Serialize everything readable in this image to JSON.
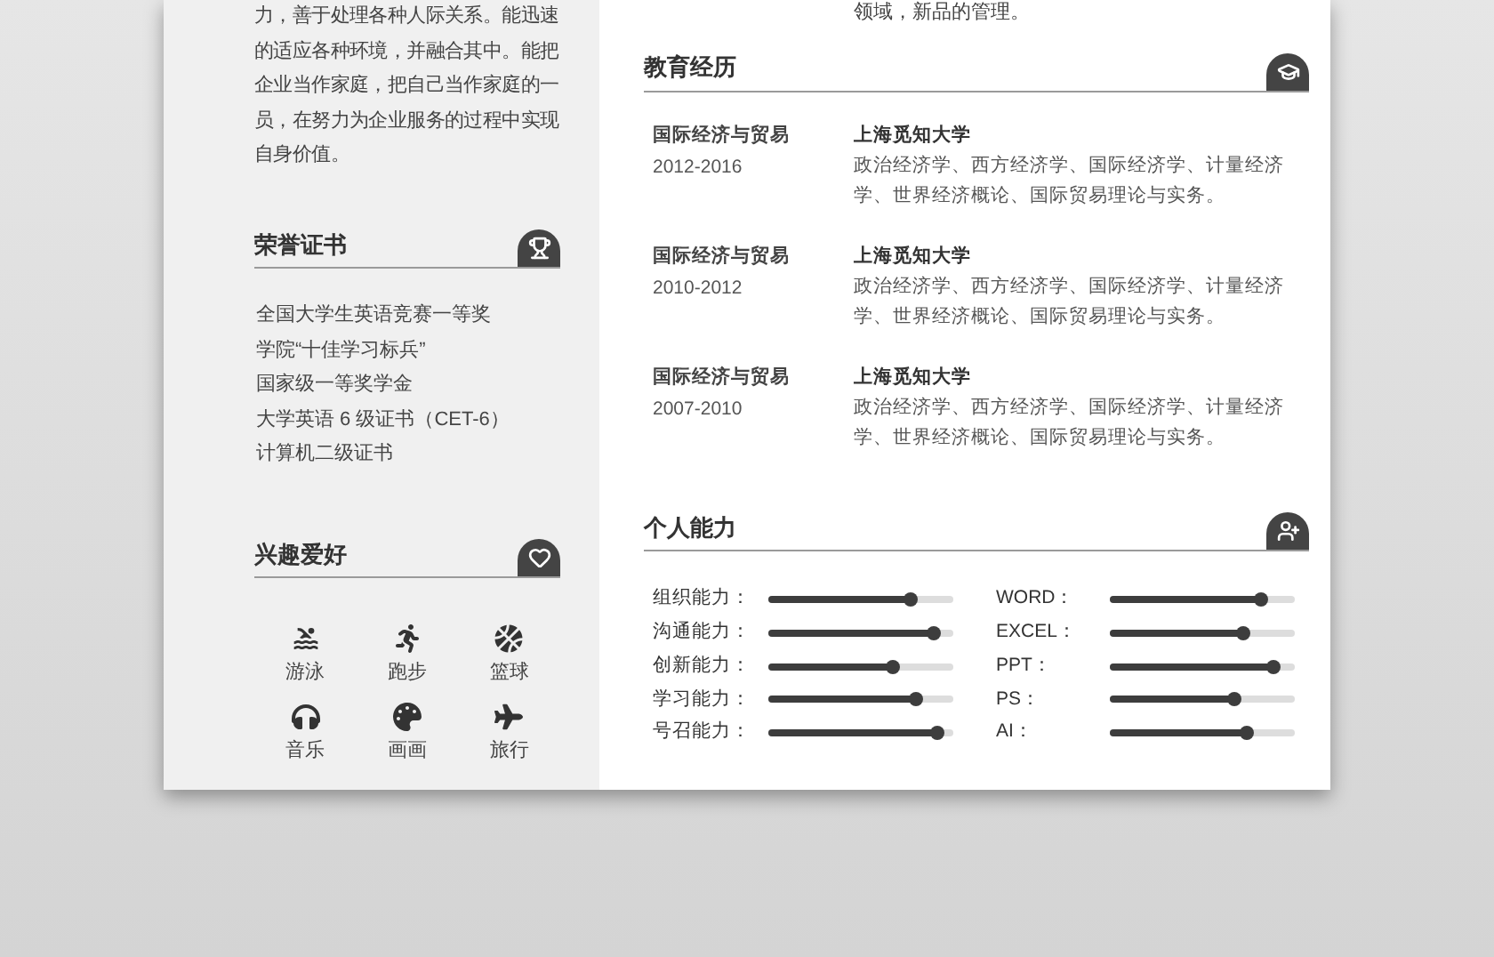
{
  "profile": {
    "text": "力，善于处理各种人际关系。能迅速的适应各种环境，并融合其中。能把企业当作家庭，把自己当作家庭的一员，在努力为企业服务的过程中实现自身价值。"
  },
  "work": {
    "text": "领域，新品的管理。"
  },
  "honors": {
    "title": "荣誉证书",
    "items": [
      "全国大学生英语竞赛一等奖",
      "学院“十佳学习标兵”",
      "国家级一等奖学金",
      "大学英语 6 级证书（CET-6）",
      "计算机二级证书"
    ]
  },
  "hobbies": {
    "title": "兴趣爱好",
    "items": [
      {
        "label": "游泳"
      },
      {
        "label": "跑步"
      },
      {
        "label": "篮球"
      },
      {
        "label": "音乐"
      },
      {
        "label": "画画"
      },
      {
        "label": "旅行"
      }
    ]
  },
  "education": {
    "title": "教育经历",
    "entries": [
      {
        "major": "国际经济与贸易",
        "years": "2012-2016",
        "school": "上海觅知大学",
        "courses": "政治经济学、西方经济学、国际经济学、计量经济学、世界经济概论、国际贸易理论与实务。"
      },
      {
        "major": "国际经济与贸易",
        "years": "2010-2012",
        "school": "上海觅知大学",
        "courses": "政治经济学、西方经济学、国际经济学、计量经济学、世界经济概论、国际贸易理论与实务。"
      },
      {
        "major": "国际经济与贸易",
        "years": "2007-2010",
        "school": "上海觅知大学",
        "courses": "政治经济学、西方经济学、国际经济学、计量经济学、世界经济概论、国际贸易理论与实务。"
      }
    ]
  },
  "skills": {
    "title": "个人能力",
    "left": [
      {
        "label": "组织能力：",
        "level": 0.77
      },
      {
        "label": "沟通能力：",
        "level": 0.89
      },
      {
        "label": "创新能力：",
        "level": 0.67
      },
      {
        "label": "学习能力：",
        "level": 0.8
      },
      {
        "label": "号召能力：",
        "level": 0.91
      }
    ],
    "right": [
      {
        "label": "WORD：",
        "level": 0.82
      },
      {
        "label": "EXCEL：",
        "level": 0.72
      },
      {
        "label": "PPT：",
        "level": 0.88
      },
      {
        "label": "PS：",
        "level": 0.67
      },
      {
        "label": "AI：",
        "level": 0.74
      }
    ]
  }
}
